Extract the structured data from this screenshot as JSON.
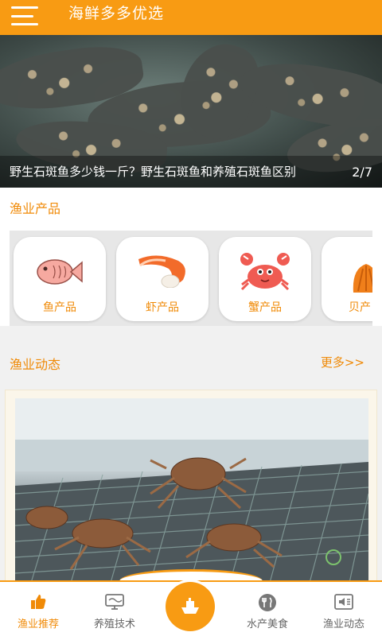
{
  "app": {
    "title": "海鲜多多优选"
  },
  "banner": {
    "caption": "野生石斑鱼多少钱一斤？野生石斑鱼和养殖石斑鱼区别",
    "page_indicator": "2/7"
  },
  "products": {
    "heading": "渔业产品",
    "items": [
      {
        "label": "鱼产品",
        "icon": "fish-icon"
      },
      {
        "label": "虾产品",
        "icon": "shrimp-icon"
      },
      {
        "label": "蟹产品",
        "icon": "crab-icon"
      },
      {
        "label": "贝产",
        "icon": "shell-icon"
      }
    ]
  },
  "news": {
    "heading": "渔业动态",
    "more_label": "更多>>"
  },
  "bottom_nav": {
    "items": [
      {
        "label": "渔业推荐",
        "icon": "thumbs-up-icon",
        "active": true
      },
      {
        "label": "养殖技术",
        "icon": "monitor-icon",
        "active": false
      },
      {
        "label": "水产美食",
        "icon": "utensils-icon",
        "active": false
      },
      {
        "label": "渔业动态",
        "icon": "speaker-icon",
        "active": false
      }
    ],
    "center_icon": "boat-icon"
  },
  "colors": {
    "accent": "#f89b13",
    "accent_text": "#f08a07",
    "background": "#f1f1f1"
  }
}
